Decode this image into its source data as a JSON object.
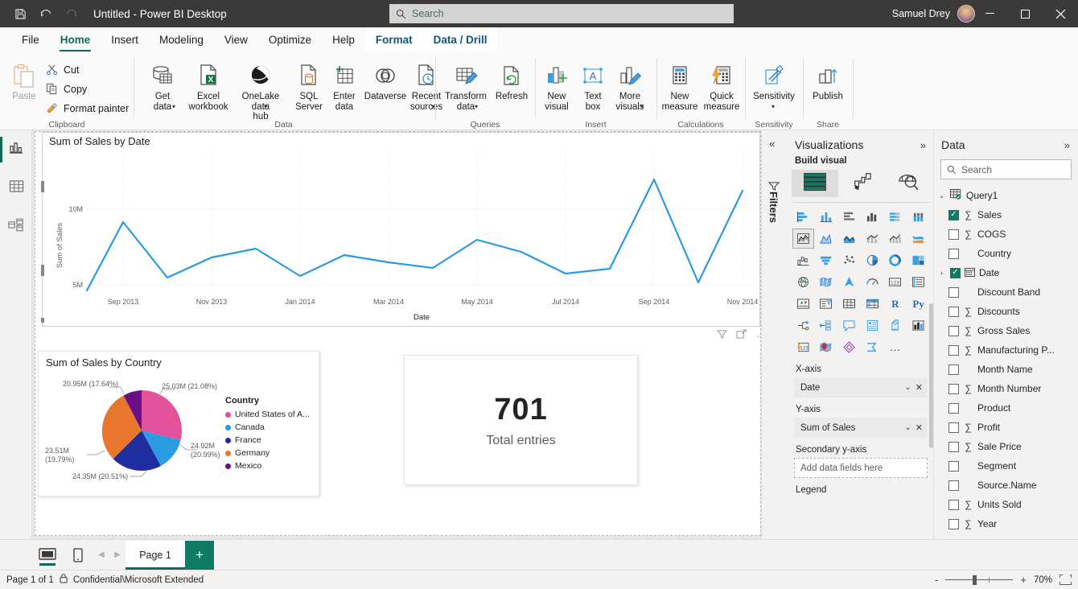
{
  "titlebar": {
    "save_icon": "save-icon",
    "undo_icon": "undo-icon",
    "redo_icon": "redo-icon",
    "title": "Untitled - Power BI Desktop",
    "search_placeholder": "Search",
    "user_name": "Samuel Drey",
    "minimize": "—",
    "maximize": "▢",
    "close": "✕"
  },
  "ribbon": {
    "tabs": [
      {
        "label": "File",
        "state": "normal"
      },
      {
        "label": "Home",
        "state": "active"
      },
      {
        "label": "Insert",
        "state": "normal"
      },
      {
        "label": "Modeling",
        "state": "normal"
      },
      {
        "label": "View",
        "state": "normal"
      },
      {
        "label": "Optimize",
        "state": "normal"
      },
      {
        "label": "Help",
        "state": "normal"
      },
      {
        "label": "Format",
        "state": "contextual"
      },
      {
        "label": "Data / Drill",
        "state": "contextual"
      }
    ],
    "groups": [
      {
        "name": "Clipboard"
      },
      {
        "name": "Data"
      },
      {
        "name": "Queries"
      },
      {
        "name": "Insert"
      },
      {
        "name": "Calculations"
      },
      {
        "name": "Sensitivity"
      },
      {
        "name": "Share"
      }
    ],
    "clipboard": {
      "paste": "Paste",
      "cut": "Cut",
      "copy": "Copy",
      "format_painter": "Format painter"
    },
    "data_group": {
      "get_data": "Get\ndata",
      "excel_workbook": "Excel\nworkbook",
      "onelake": "OneLake data\nhub",
      "sql_server": "SQL\nServer",
      "enter_data": "Enter\ndata",
      "dataverse": "Dataverse",
      "recent_sources": "Recent\nsources"
    },
    "queries_group": {
      "transform_data": "Transform\ndata",
      "refresh": "Refresh"
    },
    "insert_group": {
      "new_visual": "New\nvisual",
      "text_box": "Text\nbox",
      "more_visuals": "More\nvisuals"
    },
    "calculations_group": {
      "new_measure": "New\nmeasure",
      "quick_measure": "Quick\nmeasure"
    },
    "sensitivity_group": {
      "sensitivity": "Sensitivity"
    },
    "share_group": {
      "publish": "Publish"
    }
  },
  "rail": {
    "items": [
      {
        "name": "report-view",
        "icon": "report-bar-chart-icon",
        "active": true
      },
      {
        "name": "table-view",
        "icon": "table-grid-icon",
        "active": false
      },
      {
        "name": "model-view",
        "icon": "model-relationship-icon",
        "active": false
      }
    ]
  },
  "canvas": {
    "line_visual": {
      "title": "Sum of Sales by Date",
      "footer_icons": [
        "filter-icon",
        "focus-mode-icon",
        "more-options-icon"
      ]
    },
    "pie_visual": {
      "title": "Sum of Sales by Country",
      "legend_title": "Country"
    },
    "card_visual": {
      "value": "701",
      "label": "Total entries"
    }
  },
  "chart_data": [
    {
      "type": "line",
      "title": "Sum of Sales by Date",
      "xlabel": "Date",
      "ylabel": "Sum of Sales",
      "ylim": [
        4300000,
        12000000
      ],
      "yticks": [
        "5M",
        "10M"
      ],
      "ytick_values": [
        5000000,
        10000000
      ],
      "grid": true,
      "xticks": [
        "Sep 2013",
        "Nov 2013",
        "Jan 2014",
        "Mar 2014",
        "May 2014",
        "Jul 2014",
        "Sep 2014",
        "Nov 2014"
      ],
      "x": [
        "Sep 2013",
        "Oct 2013",
        "Nov 2013",
        "Dec 2013",
        "Jan 2014",
        "Feb 2014",
        "Mar 2014",
        "Apr 2014",
        "May 2014",
        "Jun 2014",
        "Jul 2014",
        "Aug 2014",
        "Sep 2014",
        "Oct 2014",
        "Nov 2014",
        "Dec 2014"
      ],
      "values": [
        4450000,
        9620000,
        5800000,
        7130000,
        7700000,
        5860000,
        7510000,
        7020000,
        6590000,
        8100000,
        7400000,
        6230000,
        6550000,
        11430000,
        5450000,
        11070000
      ],
      "series_color": "#2a9ae1"
    },
    {
      "type": "pie",
      "title": "Sum of Sales by Country",
      "legend_title": "Country",
      "legend_position": "right",
      "labels": [
        "United States of A...",
        "Canada",
        "France",
        "Germany",
        "Mexico"
      ],
      "full_labels": [
        "United States of America",
        "Canada",
        "France",
        "Germany",
        "Mexico"
      ],
      "values": [
        25030000,
        24920000,
        24350000,
        23510000,
        20950000
      ],
      "percents": [
        21.08,
        20.99,
        20.51,
        19.79,
        17.64
      ],
      "data_labels": [
        "25.03M (21.08%)",
        "24.92M\n(20.99%)",
        "24.35M (20.51%)",
        "23.51M\n(19.79%)",
        "20.95M (17.64%)"
      ],
      "colors": [
        "#e1529b",
        "#2a9ae1",
        "#1f2d9e",
        "#e8762d",
        "#6b0f87"
      ]
    }
  ],
  "visualizations_pane": {
    "header": "Visualizations",
    "expand_icon": "chevron-double-right-icon",
    "collapse_icon": "chevron-double-left-icon",
    "filters_label": "Filters",
    "build_label": "Build visual",
    "build_tabs": [
      {
        "name": "fields-tab",
        "icon": "fields-stack-icon",
        "selected": true
      },
      {
        "name": "format-tab",
        "icon": "format-paint-roller-icon",
        "selected": false
      },
      {
        "name": "analytics-tab",
        "icon": "analytics-magnifier-icon",
        "selected": false
      }
    ],
    "visual_types": [
      "stacked-bar-chart-icon",
      "stacked-column-chart-icon",
      "clustered-bar-chart-icon",
      "clustered-column-chart-icon",
      "100-stacked-bar-chart-icon",
      "100-stacked-column-chart-icon",
      "line-chart-icon",
      "area-chart-icon",
      "stacked-area-chart-icon",
      "line-stacked-column-chart-icon",
      "line-clustered-column-chart-icon",
      "ribbon-chart-icon",
      "waterfall-chart-icon",
      "funnel-chart-icon",
      "scatter-chart-icon",
      "pie-chart-icon",
      "donut-chart-icon",
      "treemap-icon",
      "map-icon",
      "filled-map-icon",
      "azure-map-icon",
      "gauge-icon",
      "card-icon",
      "multi-row-card-icon",
      "kpi-icon",
      "slicer-icon",
      "table-icon",
      "matrix-icon",
      "r-script-visual-icon",
      "python-visual-icon",
      "decomposition-tree-icon",
      "key-influencers-icon",
      "q-and-a-icon",
      "narrative-icon",
      "paginated-report-icon",
      "power-apps-icon",
      "smart-narrative-icon",
      "arcgis-map-icon",
      "power-automate-icon",
      "azure-stream-icon",
      "more-visuals-ellipsis-icon"
    ],
    "selected_visual_type": "line-chart-icon",
    "fields": [
      {
        "label": "X-axis",
        "value": "Date",
        "filled": true
      },
      {
        "label": "Y-axis",
        "value": "Sum of Sales",
        "filled": true
      },
      {
        "label": "Secondary y-axis",
        "value": "Add data fields here",
        "filled": false
      },
      {
        "label": "Legend",
        "value": "",
        "filled": false
      }
    ]
  },
  "data_pane": {
    "header": "Data",
    "expand_icon": "chevron-double-right-icon",
    "search_placeholder": "Search",
    "table": {
      "name": "Query1",
      "expanded": true,
      "icon": "table-checked-icon"
    },
    "fields": [
      {
        "label": "Sales",
        "checked": true,
        "sigma": true,
        "expandable": false
      },
      {
        "label": "COGS",
        "checked": false,
        "sigma": true,
        "expandable": false
      },
      {
        "label": "Country",
        "checked": false,
        "sigma": false,
        "expandable": false
      },
      {
        "label": "Date",
        "checked": true,
        "sigma": false,
        "expandable": true,
        "icon": "calendar-icon"
      },
      {
        "label": "Discount Band",
        "checked": false,
        "sigma": false,
        "expandable": false
      },
      {
        "label": "Discounts",
        "checked": false,
        "sigma": true,
        "expandable": false
      },
      {
        "label": "Gross Sales",
        "checked": false,
        "sigma": true,
        "expandable": false
      },
      {
        "label": "Manufacturing P...",
        "checked": false,
        "sigma": true,
        "expandable": false
      },
      {
        "label": "Month Name",
        "checked": false,
        "sigma": false,
        "expandable": false
      },
      {
        "label": "Month Number",
        "checked": false,
        "sigma": true,
        "expandable": false
      },
      {
        "label": "Product",
        "checked": false,
        "sigma": false,
        "expandable": false
      },
      {
        "label": "Profit",
        "checked": false,
        "sigma": true,
        "expandable": false
      },
      {
        "label": "Sale Price",
        "checked": false,
        "sigma": true,
        "expandable": false
      },
      {
        "label": "Segment",
        "checked": false,
        "sigma": false,
        "expandable": false
      },
      {
        "label": "Source.Name",
        "checked": false,
        "sigma": false,
        "expandable": false
      },
      {
        "label": "Units Sold",
        "checked": false,
        "sigma": true,
        "expandable": false
      },
      {
        "label": "Year",
        "checked": false,
        "sigma": true,
        "expandable": false
      }
    ]
  },
  "pagebar": {
    "desktop_view_icon": "desktop-layout-icon",
    "mobile_view_icon": "mobile-layout-icon",
    "prev_arrow": "◀",
    "next_arrow": "▶",
    "tabs": [
      {
        "label": "Page 1",
        "active": true
      }
    ],
    "add_page": "+"
  },
  "statusbar": {
    "page_count": "Page 1 of 1",
    "lock_icon": "lock-icon",
    "sensitivity_label": "Confidential\\Microsoft Extended",
    "zoom_out": "-",
    "zoom_in": "+",
    "zoom_level": "70%",
    "fit_icon": "fit-to-page-icon"
  },
  "colors": {
    "brand_green": "#0f6b57",
    "accent_blue": "#2a9ae1",
    "titlebar_bg": "#3b3a39",
    "pane_bg": "#f3f2f1"
  }
}
